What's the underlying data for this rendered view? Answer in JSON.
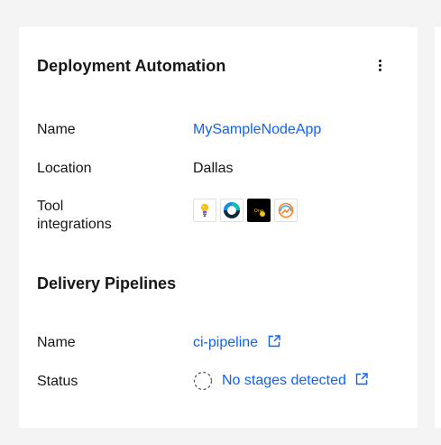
{
  "card": {
    "title": "Deployment Automation",
    "menu_icon": "overflow-menu-vertical-icon"
  },
  "details": {
    "name_label": "Name",
    "name_value": "MySampleNodeApp",
    "location_label": "Location",
    "location_value": "Dallas",
    "tools_label_line1": "Tool",
    "tools_label_line2": "integrations",
    "tools": [
      {
        "icon": "lightbulb-icon"
      },
      {
        "icon": "ring-icon"
      },
      {
        "icon": "onedark-icon"
      },
      {
        "icon": "gauge-icon"
      }
    ]
  },
  "pipelines": {
    "title": "Delivery Pipelines",
    "name_label": "Name",
    "name_value": "ci-pipeline",
    "status_label": "Status",
    "status_value": "No stages detected"
  },
  "colors": {
    "link": "#0f62fe",
    "text": "#161616",
    "background": "#f4f4f4",
    "card": "#ffffff"
  }
}
